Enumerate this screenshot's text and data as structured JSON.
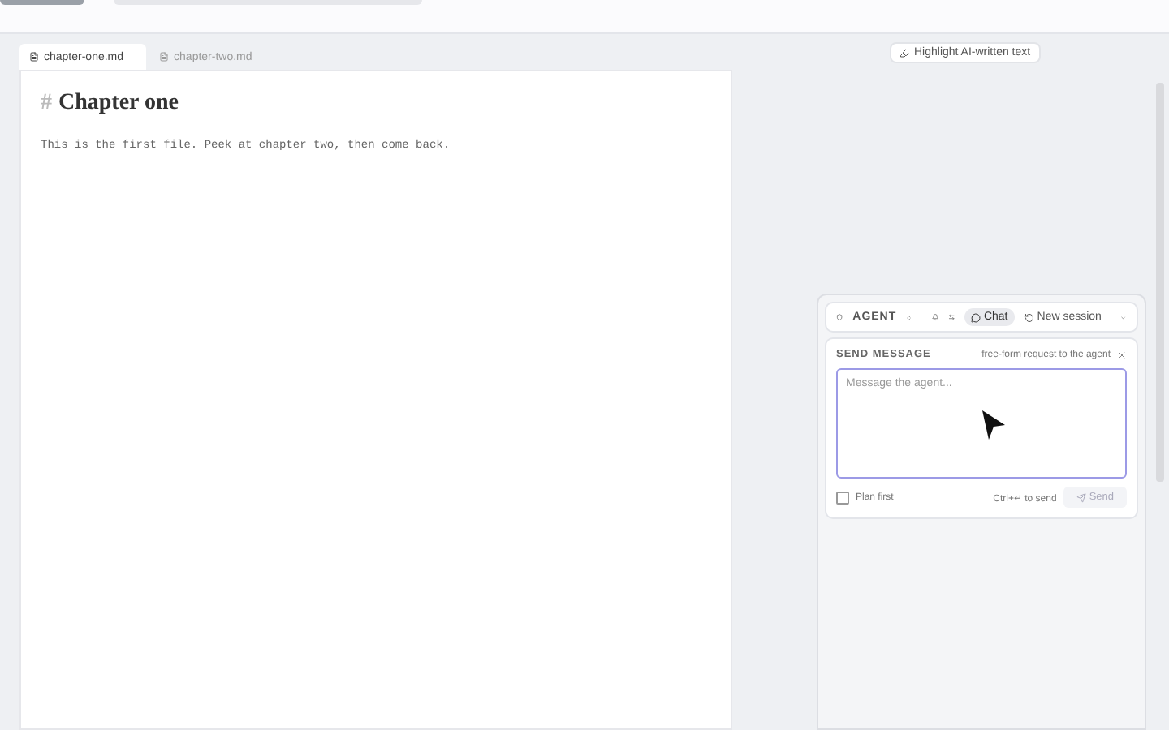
{
  "editor_tabs": [
    {
      "label": "chapter-one.md",
      "selected": true
    },
    {
      "label": "chapter-two.md",
      "selected": false
    }
  ],
  "highlight_button": "Highlight AI-written text",
  "document": {
    "heading_mark": "#",
    "heading": "Chapter one",
    "body": "This is the first file. Peek at chapter two, then come back."
  },
  "agent": {
    "label": "AGENT",
    "modes": [
      {
        "label": "Chat",
        "selected": true
      }
    ],
    "new_session": "New session",
    "send_message": {
      "title": "SEND MESSAGE",
      "hint": "free-form request to the agent",
      "placeholder": "Message the agent...",
      "plan_first": {
        "label": "Plan first",
        "checked": false
      },
      "shortcut": "Ctrl+↵ to send",
      "send": {
        "label": "Send",
        "disabled": true
      }
    }
  }
}
